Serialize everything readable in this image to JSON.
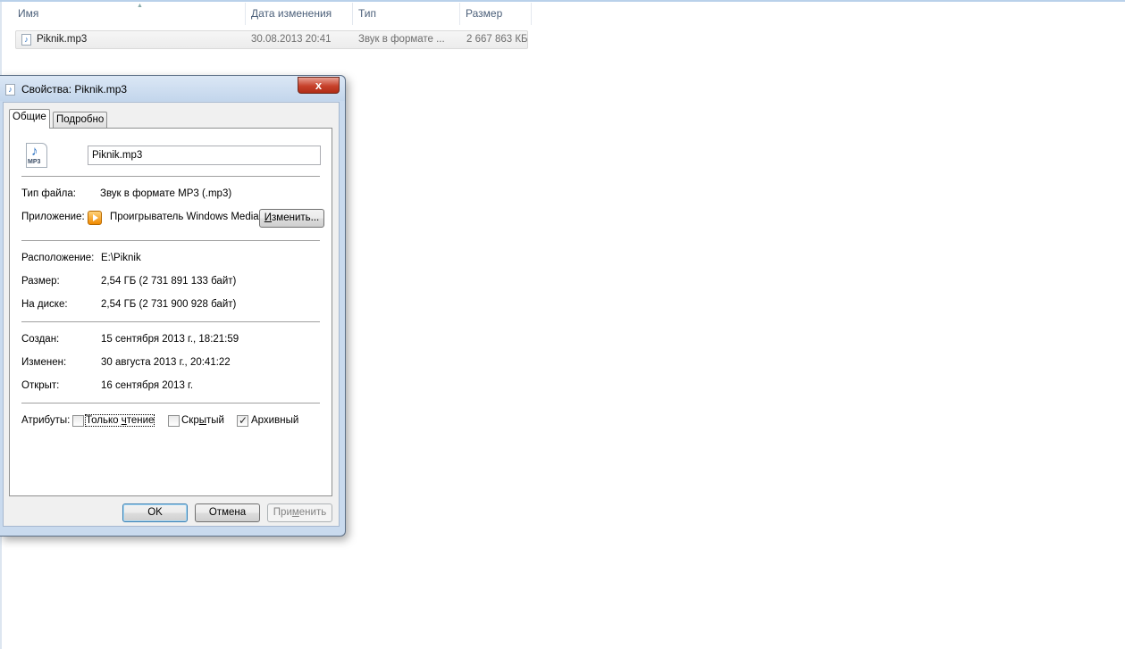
{
  "explorer": {
    "columns": [
      "Имя",
      "Дата изменения",
      "Тип",
      "Размер"
    ],
    "file": {
      "name": "Piknik.mp3",
      "modified": "30.08.2013 20:41",
      "type": "Звук в формате ...",
      "size": "2 667 863 КБ"
    }
  },
  "dialog": {
    "title": "Свойства: Piknik.mp3",
    "close_glyph": "x",
    "tabs": [
      "Общие",
      "Подробно"
    ],
    "file_icon_label": "MP3",
    "file_name": "Piknik.mp3",
    "rows": {
      "file_type_label": "Тип файла:",
      "file_type": "Звук в формате MP3 (.mp3)",
      "app_label": "Приложение:",
      "app": "Проигрыватель Windows Media",
      "change_button_pre": "",
      "change_button_ul": "И",
      "change_button_post": "зменить...",
      "location_label": "Расположение:",
      "location": "E:\\Piknik",
      "size_label": "Размер:",
      "size": "2,54 ГБ (2 731 891 133 байт)",
      "disk_label": "На диске:",
      "disk": "2,54 ГБ (2 731 900 928 байт)",
      "created_label": "Создан:",
      "created": "15 сентября 2013 г., 18:21:59",
      "modified_label": "Изменен:",
      "modified": "30 августа 2013 г., 20:41:22",
      "opened_label": "Открыт:",
      "opened": "16 сентября 2013 г."
    },
    "attributes": {
      "label": "Атрибуты:",
      "readonly_pre": "Только ",
      "readonly_ul": "ч",
      "readonly_post": "тение",
      "readonly_checked": false,
      "hidden_pre": "Скр",
      "hidden_ul": "ы",
      "hidden_post": "тый",
      "hidden_checked": false,
      "archive_label": "Архивный",
      "archive_checked": true
    },
    "buttons": {
      "ok": "OK",
      "cancel": "Отмена",
      "apply_pre": "При",
      "apply_ul": "м",
      "apply_post": "енить"
    }
  }
}
